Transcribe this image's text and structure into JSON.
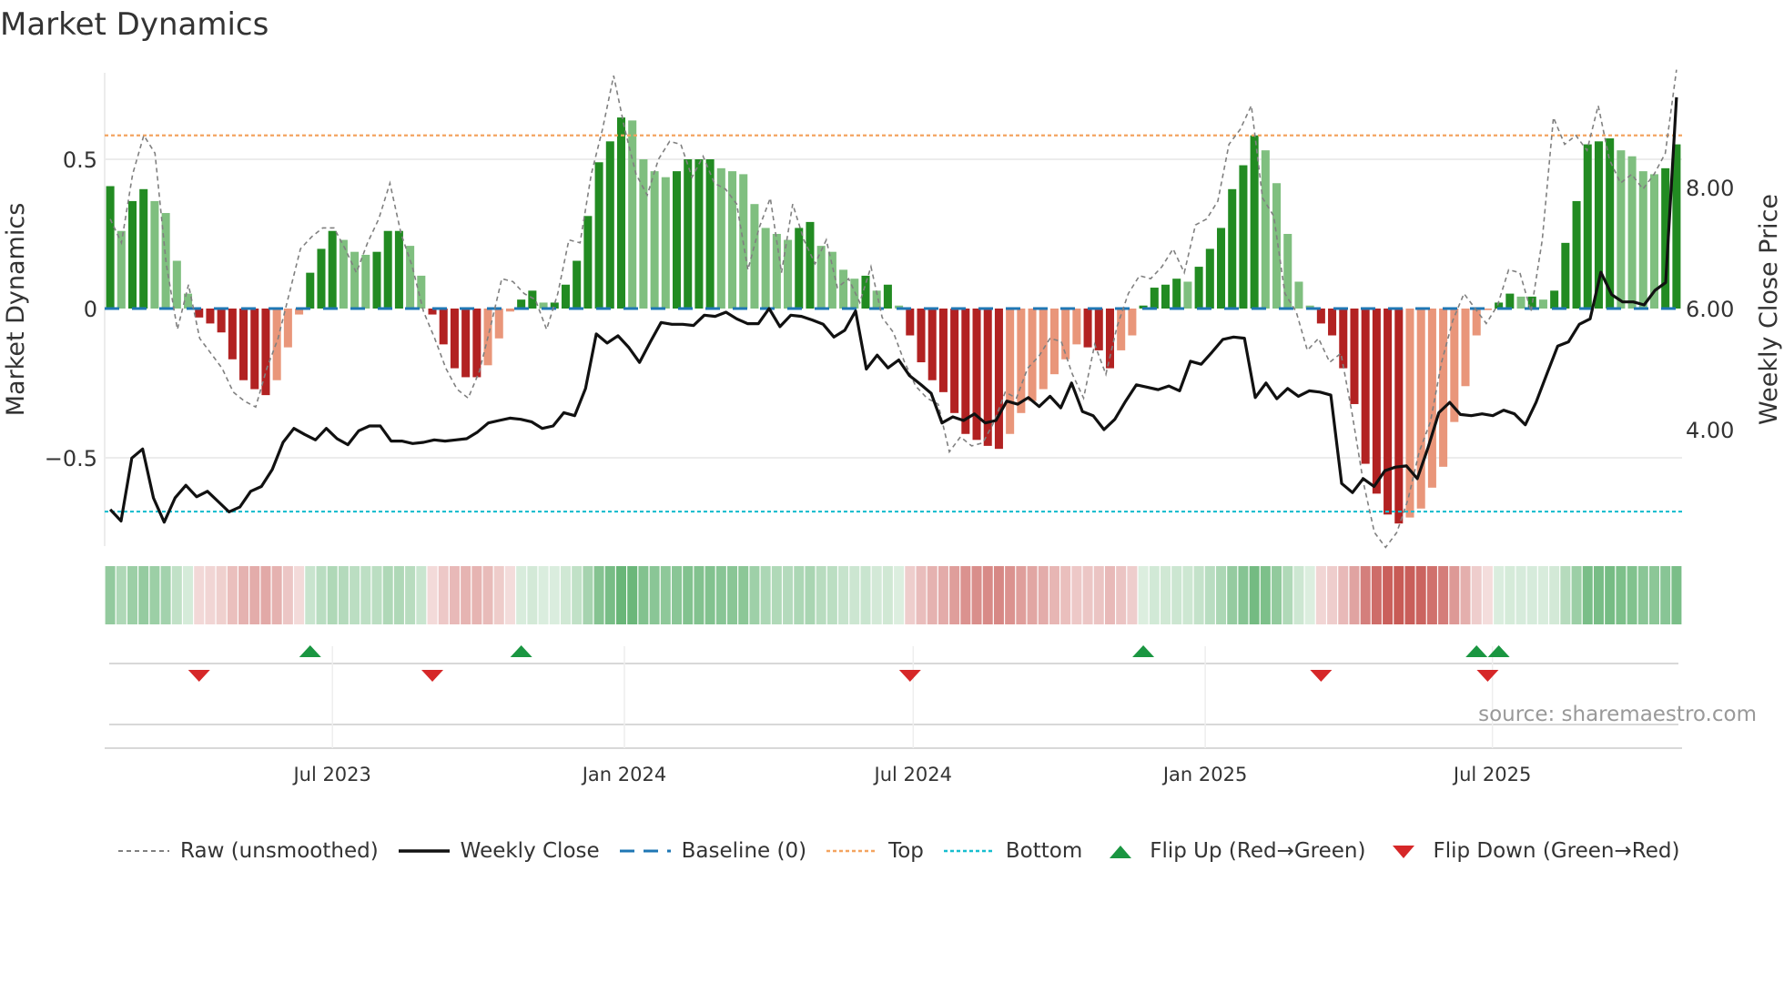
{
  "chart_data": {
    "type": "bar",
    "title": "Market Dynamics",
    "ylabel": "Market Dynamics",
    "y2label": "Weekly Close Price",
    "ylim": [
      -0.8,
      0.8
    ],
    "y2lim": [
      2.0,
      9.6
    ],
    "yticks": [
      {
        "v": 0.5,
        "label": "0.5"
      },
      {
        "v": 0,
        "label": "0"
      },
      {
        "v": -0.5,
        "label": "−0.5"
      }
    ],
    "y2ticks": [
      {
        "v": 8,
        "label": "8.00"
      },
      {
        "v": 6,
        "label": "6.00"
      },
      {
        "v": 4,
        "label": "4.00"
      }
    ],
    "start_date": "2023-02-11",
    "frequency": "weekly",
    "xticks": [
      {
        "date": "2023-07-01",
        "label": "Jul 2023"
      },
      {
        "date": "2024-01-01",
        "label": "Jan 2024"
      },
      {
        "date": "2024-07-01",
        "label": "Jul 2024"
      },
      {
        "date": "2025-01-01",
        "label": "Jan 2025"
      },
      {
        "date": "2025-07-01",
        "label": "Jul 2025"
      }
    ],
    "top_level": 0.58,
    "bottom_level": -0.68,
    "values": [
      0.41,
      0.26,
      0.36,
      0.4,
      0.36,
      0.32,
      0.16,
      0.05,
      -0.03,
      -0.05,
      -0.08,
      -0.17,
      -0.24,
      -0.27,
      -0.29,
      -0.24,
      -0.13,
      -0.02,
      0.12,
      0.2,
      0.26,
      0.23,
      0.19,
      0.18,
      0.19,
      0.26,
      0.26,
      0.21,
      0.11,
      -0.02,
      -0.12,
      -0.2,
      -0.23,
      -0.23,
      -0.19,
      -0.1,
      -0.01,
      0.03,
      0.06,
      0.02,
      0.02,
      0.08,
      0.16,
      0.31,
      0.49,
      0.56,
      0.64,
      0.63,
      0.5,
      0.46,
      0.44,
      0.46,
      0.5,
      0.5,
      0.5,
      0.47,
      0.46,
      0.45,
      0.35,
      0.27,
      0.25,
      0.23,
      0.27,
      0.29,
      0.21,
      0.19,
      0.13,
      0.1,
      0.11,
      0.06,
      0.08,
      0.01,
      -0.09,
      -0.18,
      -0.24,
      -0.28,
      -0.35,
      -0.42,
      -0.44,
      -0.46,
      -0.47,
      -0.42,
      -0.35,
      -0.31,
      -0.27,
      -0.22,
      -0.17,
      -0.12,
      -0.13,
      -0.14,
      -0.2,
      -0.14,
      -0.09,
      0.01,
      0.07,
      0.08,
      0.1,
      0.09,
      0.14,
      0.2,
      0.27,
      0.4,
      0.48,
      0.58,
      0.53,
      0.42,
      0.25,
      0.09,
      0.01,
      -0.05,
      -0.09,
      -0.2,
      -0.32,
      -0.52,
      -0.62,
      -0.69,
      -0.72,
      -0.7,
      -0.67,
      -0.6,
      -0.53,
      -0.38,
      -0.26,
      -0.09,
      -0.005,
      0.02,
      0.05,
      0.04,
      0.04,
      0.03,
      0.06,
      0.22,
      0.36,
      0.55,
      0.56,
      0.57,
      0.53,
      0.51,
      0.46,
      0.45,
      0.47,
      0.55
    ],
    "raw": [
      0.3,
      0.22,
      0.45,
      0.58,
      0.52,
      0.15,
      -0.07,
      0.08,
      -0.1,
      -0.15,
      -0.2,
      -0.28,
      -0.31,
      -0.33,
      -0.2,
      -0.1,
      0.05,
      0.2,
      0.24,
      0.27,
      0.27,
      0.2,
      0.12,
      0.22,
      0.3,
      0.42,
      0.25,
      0.14,
      -0.01,
      -0.1,
      -0.2,
      -0.27,
      -0.3,
      -0.21,
      -0.06,
      0.1,
      0.09,
      0.05,
      0.03,
      -0.07,
      0.05,
      0.23,
      0.22,
      0.45,
      0.6,
      0.78,
      0.6,
      0.45,
      0.38,
      0.5,
      0.56,
      0.55,
      0.44,
      0.51,
      0.42,
      0.4,
      0.35,
      0.13,
      0.27,
      0.37,
      0.12,
      0.35,
      0.23,
      0.15,
      0.23,
      0.07,
      0.1,
      0.02,
      0.14,
      -0.03,
      -0.08,
      -0.18,
      -0.26,
      -0.3,
      -0.32,
      -0.48,
      -0.43,
      -0.46,
      -0.45,
      -0.38,
      -0.28,
      -0.3,
      -0.2,
      -0.16,
      -0.1,
      -0.11,
      -0.22,
      -0.3,
      -0.12,
      -0.22,
      -0.06,
      0.05,
      0.11,
      0.1,
      0.14,
      0.2,
      0.12,
      0.28,
      0.3,
      0.36,
      0.55,
      0.6,
      0.68,
      0.37,
      0.31,
      0.05,
      -0.01,
      -0.14,
      -0.1,
      -0.18,
      -0.15,
      -0.35,
      -0.58,
      -0.75,
      -0.8,
      -0.75,
      -0.64,
      -0.48,
      -0.38,
      -0.18,
      -0.04,
      0.05,
      0.0,
      -0.05,
      0.01,
      0.13,
      0.12,
      -0.01,
      0.23,
      0.64,
      0.55,
      0.58,
      0.53,
      0.68,
      0.5,
      0.42,
      0.45,
      0.4,
      0.45,
      0.52,
      0.8
    ],
    "close": [
      2.68,
      2.49,
      3.53,
      3.68,
      2.87,
      2.47,
      2.87,
      3.08,
      2.89,
      2.98,
      2.81,
      2.64,
      2.72,
      2.98,
      3.06,
      3.34,
      3.79,
      4.02,
      3.92,
      3.83,
      4.02,
      3.85,
      3.75,
      3.98,
      4.06,
      4.06,
      3.81,
      3.81,
      3.77,
      3.79,
      3.83,
      3.81,
      3.83,
      3.85,
      3.96,
      4.11,
      4.15,
      4.19,
      4.17,
      4.13,
      4.02,
      4.06,
      4.28,
      4.23,
      4.68,
      5.58,
      5.43,
      5.55,
      5.36,
      5.11,
      5.45,
      5.77,
      5.74,
      5.74,
      5.72,
      5.89,
      5.87,
      5.94,
      5.83,
      5.75,
      5.75,
      6.0,
      5.7,
      5.89,
      5.87,
      5.81,
      5.74,
      5.53,
      5.64,
      5.96,
      5.0,
      5.23,
      5.02,
      5.15,
      4.89,
      4.75,
      4.6,
      4.11,
      4.21,
      4.15,
      4.26,
      4.11,
      4.15,
      4.47,
      4.42,
      4.53,
      4.38,
      4.55,
      4.36,
      4.77,
      4.3,
      4.23,
      4.0,
      4.17,
      4.47,
      4.74,
      4.7,
      4.66,
      4.72,
      4.64,
      5.13,
      5.08,
      5.28,
      5.49,
      5.53,
      5.51,
      4.53,
      4.77,
      4.51,
      4.68,
      4.55,
      4.64,
      4.62,
      4.57,
      3.11,
      2.96,
      3.19,
      3.06,
      3.32,
      3.38,
      3.4,
      3.19,
      3.7,
      4.28,
      4.45,
      4.25,
      4.23,
      4.26,
      4.23,
      4.32,
      4.26,
      4.08,
      4.45,
      4.92,
      5.38,
      5.45,
      5.74,
      5.83,
      6.6,
      6.23,
      6.11,
      6.11,
      6.06,
      6.3,
      6.43,
      9.49
    ],
    "flip_up_weeks": [
      18,
      37,
      93,
      123,
      125
    ],
    "flip_down_weeks": [
      8,
      29,
      72,
      109,
      124
    ],
    "colors": {
      "strong_up": "#228b22",
      "weak_up": "#7fbf7f",
      "strong_down": "#b22222",
      "weak_down": "#e9967a",
      "raw": "#808080",
      "close": "#111111",
      "baseline": "#1f77b4",
      "top": "#f4a460",
      "bottom": "#17becf",
      "flip_up": "#1a9641",
      "flip_down": "#d62728"
    },
    "legend": {
      "raw": "Raw (unsmoothed)",
      "close": "Weekly Close",
      "baseline": "Baseline (0)",
      "top": "Top",
      "bottom": "Bottom",
      "flip_up": "Flip Up (Red→Green)",
      "flip_down": "Flip Down (Green→Red)"
    },
    "source": "source: sharemaestro.com"
  }
}
